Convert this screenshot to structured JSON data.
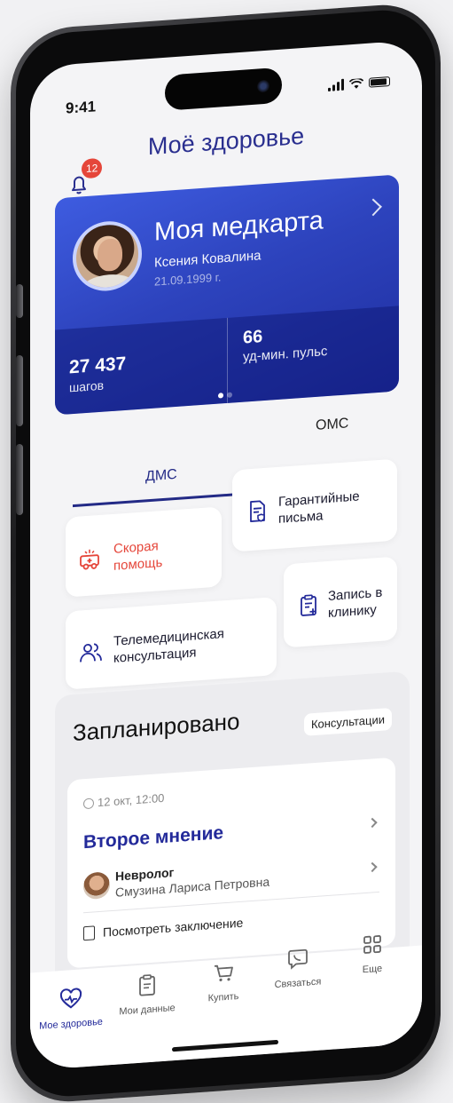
{
  "status_bar": {
    "time": "9:41"
  },
  "header": {
    "title": "Моё здоровье",
    "notification_count": "12"
  },
  "medcard": {
    "title": "Моя медкарта",
    "patient_name": "Ксения Ковалина",
    "birth_date": "21.09.1999 г.",
    "steps_value": "27 437",
    "steps_label": "шагов",
    "pulse_value": "66",
    "pulse_label": "уд-мин. пульс",
    "page_index": 0,
    "page_count": 2
  },
  "insurance_tabs": [
    {
      "label": "ДМС",
      "active": true
    },
    {
      "label": "ОМС",
      "active": false
    }
  ],
  "services": {
    "ambulance": "Скорая помощь",
    "guarantee_letters": "Гарантийные письма",
    "telemedicine": "Телемедицинская консультация",
    "clinic_appointment": "Запись в клинику"
  },
  "planned": {
    "title": "Запланировано",
    "filter_chip": "Консультации",
    "appointment": {
      "datetime": "12 окт, 12:00",
      "type": "Второе мнение",
      "specialty": "Невролог",
      "doctor": "Смузина Лариса Петровна",
      "conclusion_link": "Посмотреть заключение"
    }
  },
  "bottom_nav": [
    {
      "label": "Мое здоровье",
      "icon": "heart-pulse-icon",
      "active": true
    },
    {
      "label": "Мои данные",
      "icon": "clipboard-icon",
      "active": false
    },
    {
      "label": "Купить",
      "icon": "cart-icon",
      "active": false
    },
    {
      "label": "Связаться",
      "icon": "phone-message-icon",
      "active": false
    },
    {
      "label": "Еще",
      "icon": "grid-icon",
      "active": false
    }
  ],
  "colors": {
    "accent": "#232a9a",
    "card_blue": "#2d43bd",
    "alert_red": "#e5463a",
    "background": "#f4f4f6"
  }
}
